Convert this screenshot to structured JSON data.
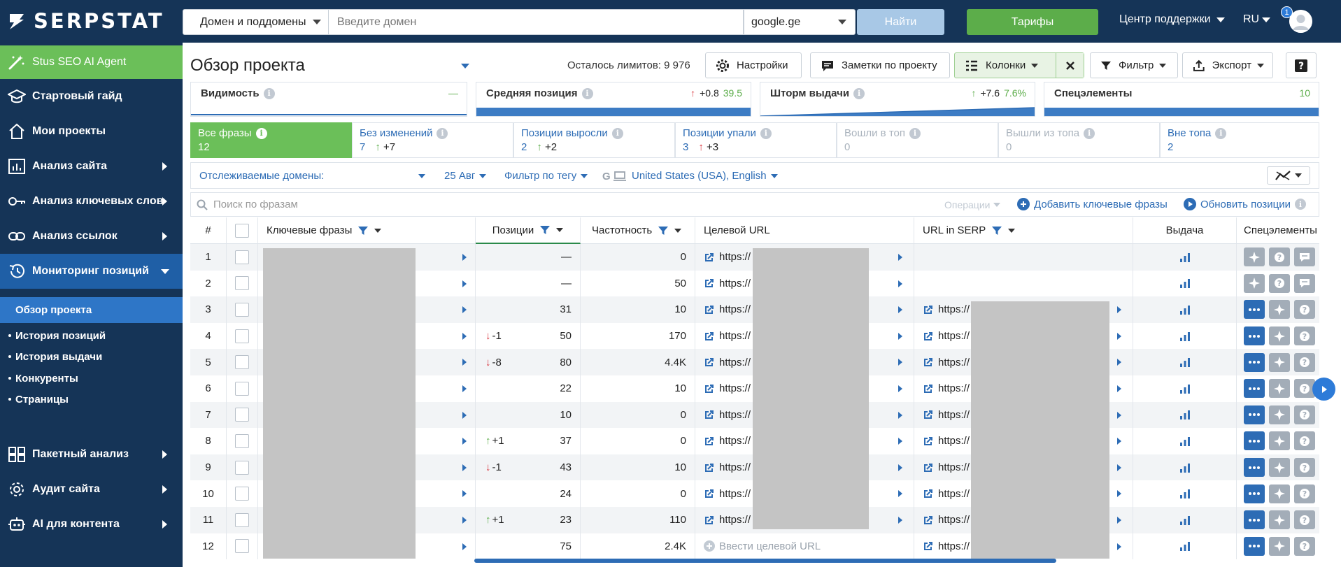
{
  "brand": {
    "name": "SERPSTAT"
  },
  "topbar": {
    "domain_mode": "Домен и поддомены",
    "domain_placeholder": "Введите домен",
    "engine": "google.ge",
    "find_label": "Найти",
    "tariffs_label": "Тарифы",
    "support_label": "Центр поддержки",
    "lang": "RU",
    "notif_count": "1"
  },
  "sidebar": {
    "ai_agent": "Stus SEO AI Agent",
    "items": [
      {
        "label": "Стартовый гайд"
      },
      {
        "label": "Мои проекты"
      },
      {
        "label": "Анализ сайта"
      },
      {
        "label": "Анализ ключевых слов"
      },
      {
        "label": "Анализ ссылок"
      },
      {
        "label": "Мониторинг позиций"
      }
    ],
    "active_sub": "Обзор проекта",
    "subs": [
      "История позиций",
      "История выдачи",
      "Конкуренты",
      "Страницы"
    ],
    "items2": [
      {
        "label": "Пакетный анализ"
      },
      {
        "label": "Аудит сайта"
      },
      {
        "label": "AI для контента"
      }
    ]
  },
  "header": {
    "title": "Обзор проекта",
    "limits": "Осталось лимитов: 9 976",
    "settings": "Настройки",
    "notes": "Заметки по проекту",
    "columns": "Колонки",
    "filter": "Фильтр",
    "export": "Экспорт"
  },
  "cards": [
    {
      "label": "Видимость",
      "delta": "",
      "value": "—"
    },
    {
      "label": "Средняя позиция",
      "delta": "+0.8",
      "value": "39.5"
    },
    {
      "label": "Шторм выдачи",
      "delta": "+7.6",
      "value": "7.6%"
    },
    {
      "label": "Спецэлементы",
      "delta": "",
      "value": "10"
    }
  ],
  "tabs": [
    {
      "label": "Все фразы",
      "count": "12",
      "delta": ""
    },
    {
      "label": "Без изменений",
      "count": "7",
      "delta": "+7"
    },
    {
      "label": "Позиции выросли",
      "count": "2",
      "delta": "+2"
    },
    {
      "label": "Позиции упали",
      "count": "3",
      "delta": "+3"
    },
    {
      "label": "Вошли в топ",
      "count": "0",
      "delta": ""
    },
    {
      "label": "Вышли из топа",
      "count": "0",
      "delta": ""
    },
    {
      "label": "Вне топа",
      "count": "2",
      "delta": ""
    }
  ],
  "filters": {
    "tracked_domains": "Отслеживаемые домены:",
    "date": "25 Авг",
    "tag_filter": "Фильтр по тегу",
    "region": "United States (USA), English"
  },
  "table_tools": {
    "search_placeholder": "Поиск по фразам",
    "operations": "Операции",
    "add_keywords": "Добавить ключевые фразы",
    "update_positions": "Обновить позиции"
  },
  "table": {
    "headers": {
      "num": "#",
      "keywords": "Ключевые фразы",
      "positions": "Позиции",
      "frequency": "Частотность",
      "target_url": "Целевой URL",
      "serp_url": "URL in SERP",
      "serp": "Выдача",
      "special": "Спецэлементы"
    },
    "url_prefix": "https://",
    "enter_target": "Ввести целевой URL",
    "rows": [
      {
        "n": "1",
        "change": "",
        "dir": "",
        "pos": "—",
        "freq": "0",
        "target": true,
        "serp": false,
        "spec": "gray3"
      },
      {
        "n": "2",
        "change": "",
        "dir": "",
        "pos": "—",
        "freq": "50",
        "target": true,
        "serp": false,
        "spec": "gray3"
      },
      {
        "n": "3",
        "change": "",
        "dir": "",
        "pos": "31",
        "freq": "10",
        "target": true,
        "serp": true,
        "spec": "blue3"
      },
      {
        "n": "4",
        "change": "-1",
        "dir": "down",
        "pos": "50",
        "freq": "170",
        "target": true,
        "serp": true,
        "spec": "blue3"
      },
      {
        "n": "5",
        "change": "-8",
        "dir": "down",
        "pos": "80",
        "freq": "4.4K",
        "target": true,
        "serp": true,
        "spec": "blue3"
      },
      {
        "n": "6",
        "change": "",
        "dir": "",
        "pos": "22",
        "freq": "10",
        "target": true,
        "serp": true,
        "spec": "blue3"
      },
      {
        "n": "7",
        "change": "",
        "dir": "",
        "pos": "10",
        "freq": "0",
        "target": true,
        "serp": true,
        "spec": "blue3"
      },
      {
        "n": "8",
        "change": "+1",
        "dir": "up",
        "pos": "37",
        "freq": "0",
        "target": true,
        "serp": true,
        "spec": "blue3"
      },
      {
        "n": "9",
        "change": "-1",
        "dir": "down",
        "pos": "43",
        "freq": "10",
        "target": true,
        "serp": true,
        "spec": "blue3"
      },
      {
        "n": "10",
        "change": "",
        "dir": "",
        "pos": "24",
        "freq": "0",
        "target": true,
        "serp": true,
        "spec": "blue3"
      },
      {
        "n": "11",
        "change": "+1",
        "dir": "up",
        "pos": "23",
        "freq": "110",
        "target": true,
        "serp": true,
        "spec": "blue3"
      },
      {
        "n": "12",
        "change": "",
        "dir": "",
        "pos": "75",
        "freq": "2.4K",
        "target": false,
        "serp": true,
        "spec": "blue3"
      }
    ]
  },
  "colors": {
    "navy": "#153457",
    "green": "#6bbf59",
    "blue": "#2d6cb5",
    "red": "#d9363e"
  }
}
